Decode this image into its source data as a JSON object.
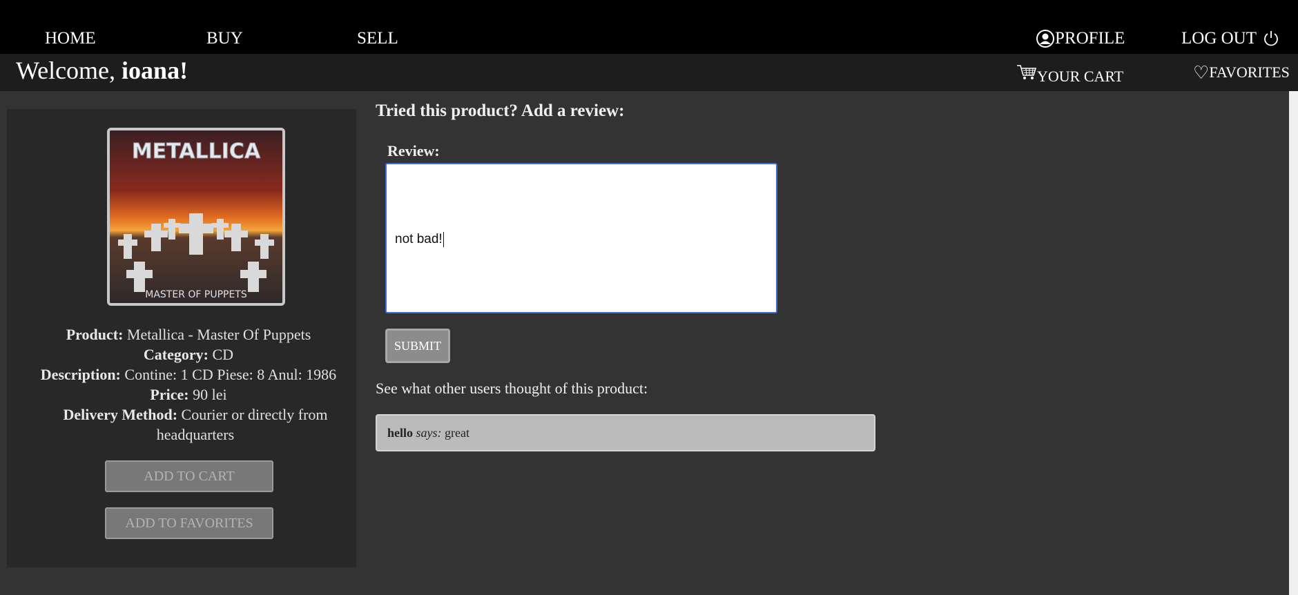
{
  "nav": {
    "home": "HOME",
    "buy": "BUY",
    "sell": "SELL",
    "profile": "PROFILE",
    "logout": "LOG OUT"
  },
  "welcome": {
    "prefix": "Welcome,",
    "username": "ioana!"
  },
  "header_links": {
    "cart": "YOUR CART",
    "favorites": "FAVORITES"
  },
  "product": {
    "album_cover_title": "METALLICA",
    "album_cover_subtitle": "MASTER OF PUPPETS",
    "product_label": "Product:",
    "product_value": "Metallica - Master Of Puppets",
    "category_label": "Category:",
    "category_value": "CD",
    "description_label": "Description:",
    "description_value": "Contine: 1 CD Piese: 8 Anul: 1986",
    "price_label": "Price:",
    "price_value": "90 lei",
    "delivery_label": "Delivery Method:",
    "delivery_value": "Courier or directly from headquarters",
    "add_to_cart": "ADD TO CART",
    "add_to_favorites": "ADD TO FAVORITES"
  },
  "review_form": {
    "title": "Tried this product? Add a review:",
    "label": "Review:",
    "value": "not bad!",
    "submit": "SUBMIT"
  },
  "reviews": {
    "title": "See what other users thought of this product:",
    "items": [
      {
        "user": "hello",
        "says": "says:",
        "text": "great"
      }
    ]
  }
}
